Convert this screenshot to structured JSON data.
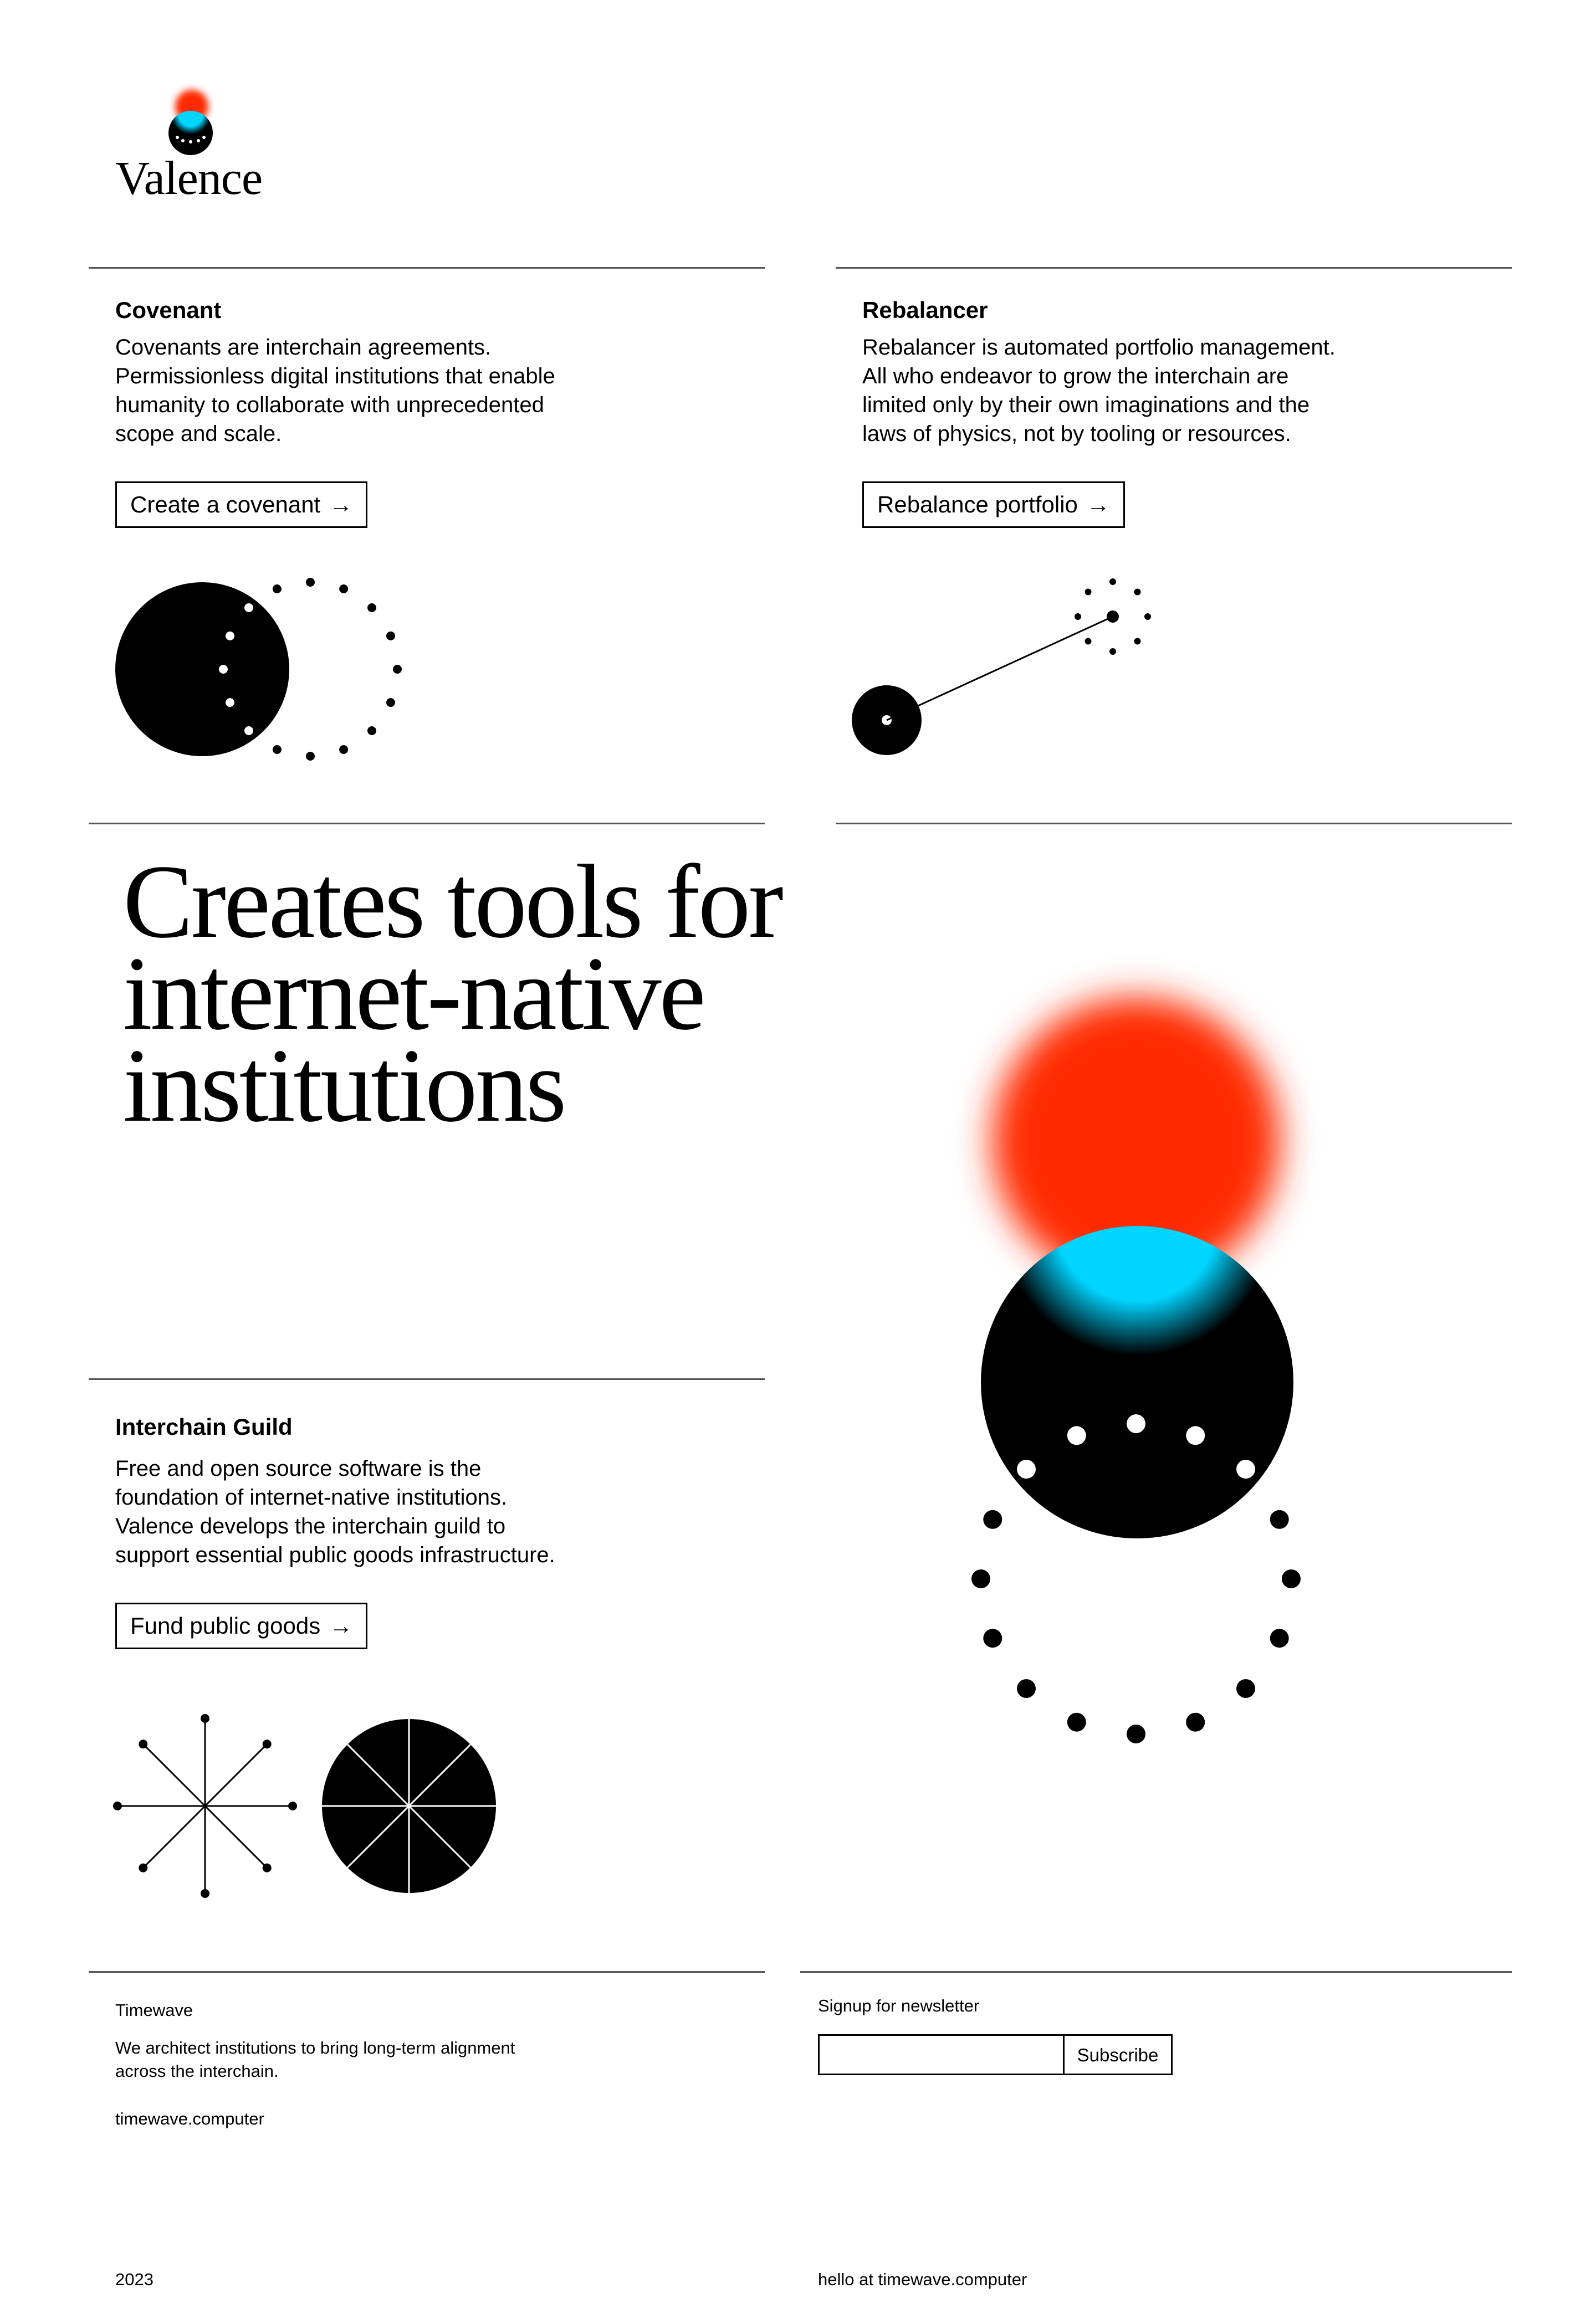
{
  "brand": {
    "name": "Valence"
  },
  "cards": {
    "covenant": {
      "title": "Covenant",
      "body": [
        "Covenants are interchain agreements.",
        "Permissionless digital institutions that enable",
        "humanity to collaborate with unprecedented",
        "scope and scale."
      ],
      "button": "Create a covenant"
    },
    "rebalancer": {
      "title": "Rebalancer",
      "body": [
        "Rebalancer is automated portfolio management.",
        "All who endeavor to grow the interchain are",
        "limited only by their own imaginations and the",
        "laws of physics, not by tooling or resources."
      ],
      "button": "Rebalance portfolio"
    },
    "guild": {
      "title": "Interchain Guild",
      "body": [
        "Free and open source software is the",
        "foundation of internet-native institutions.",
        "Valence develops the interchain guild to",
        "support essential public goods infrastructure."
      ],
      "button": "Fund public goods"
    }
  },
  "headline": [
    "Creates tools for",
    "internet-native",
    "institutions"
  ],
  "footer": {
    "company": "Timewave",
    "tagline": [
      "We architect institutions to bring long-term alignment",
      "across the interchain."
    ],
    "website": "timewave.computer",
    "newsletter_label": "Signup for newsletter",
    "newsletter_value": "",
    "subscribe": "Subscribe",
    "year": "2023",
    "contact": "hello at timewave.computer"
  },
  "icons": {
    "button_arrow": "arrow-right-icon",
    "logo": "valence-logo-icon",
    "covenant": "covenant-orbit-icon",
    "rebalancer": "rebalancer-link-icon",
    "guild": "guild-star-icon",
    "hero": "hero-orb-illustration"
  },
  "colors": {
    "accent_red": "#ff2a00",
    "accent_cyan": "#00d4ff",
    "ink": "#000000",
    "rule": "#555555",
    "background": "#ffffff"
  }
}
